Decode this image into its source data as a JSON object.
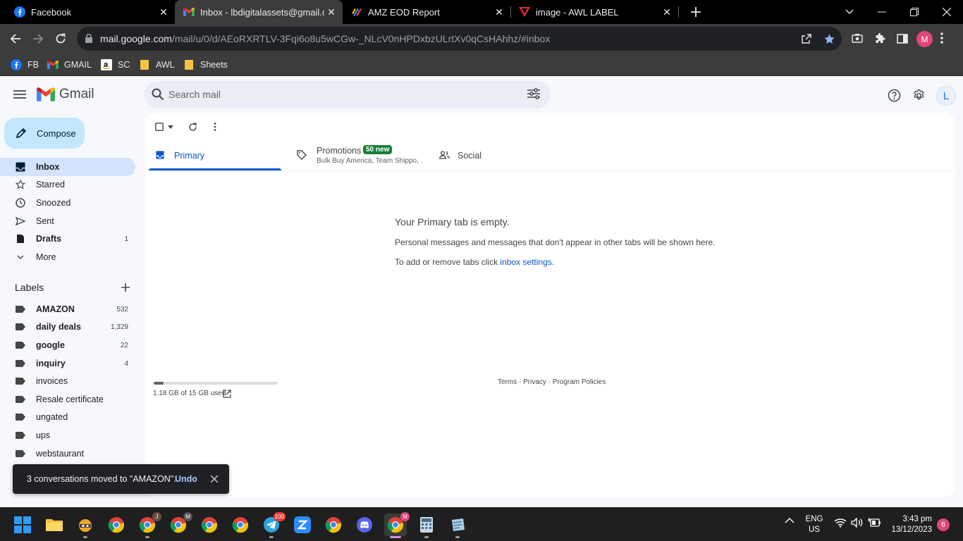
{
  "browser": {
    "tabs": [
      {
        "title": "Facebook",
        "icon": "facebook-icon"
      },
      {
        "title": "Inbox - lbdigitalassets@gmail.com",
        "icon": "gmail-icon"
      },
      {
        "title": "AMZ EOD Report",
        "icon": "sheets-icon"
      },
      {
        "title": "image - AWL LABEL",
        "icon": "awl-icon"
      }
    ],
    "url_host": "mail.google.com",
    "url_path": "/mail/u/0/d/AEoRXRTLV-3Fqi6o8u5wCGw-_NLcV0nHPDxbzULrtXv0qCsHAhhz/#inbox",
    "profile_initial": "M",
    "bookmarks": [
      {
        "label": "FB",
        "icon": "facebook-icon"
      },
      {
        "label": "GMAIL",
        "icon": "gmail-icon"
      },
      {
        "label": "SC",
        "icon": "amazon-icon"
      },
      {
        "label": "AWL",
        "icon": "folder-icon"
      },
      {
        "label": "Sheets",
        "icon": "folder-icon"
      }
    ]
  },
  "gmail": {
    "brand": "Gmail",
    "search_placeholder": "Search mail",
    "account_initial": "L",
    "compose_label": "Compose",
    "nav": [
      {
        "label": "Inbox",
        "count": ""
      },
      {
        "label": "Starred",
        "count": ""
      },
      {
        "label": "Snoozed",
        "count": ""
      },
      {
        "label": "Sent",
        "count": ""
      },
      {
        "label": "Drafts",
        "count": "1"
      },
      {
        "label": "More",
        "count": ""
      }
    ],
    "labels_heading": "Labels",
    "labels": [
      {
        "label": "AMAZON",
        "count": "532"
      },
      {
        "label": "daily deals",
        "count": "1,329"
      },
      {
        "label": "google",
        "count": "22"
      },
      {
        "label": "inquiry",
        "count": "4"
      },
      {
        "label": "invoices",
        "count": ""
      },
      {
        "label": "Resale certificate",
        "count": ""
      },
      {
        "label": "ungated",
        "count": ""
      },
      {
        "label": "ups",
        "count": ""
      },
      {
        "label": "webstaurant",
        "count": ""
      }
    ],
    "category_tabs": {
      "primary": "Primary",
      "promotions": "Promotions",
      "promotions_badge": "50 new",
      "promotions_sub": "Bulk Buy America, Team Shippo, ...",
      "social": "Social"
    },
    "empty": {
      "title": "Your Primary tab is empty.",
      "description": "Personal messages and messages that don't appear in other tabs will be shown here.",
      "settings_prefix": "To add or remove tabs click ",
      "settings_link": "inbox settings",
      "settings_suffix": "."
    },
    "storage": {
      "text": "1.18 GB of 15 GB used",
      "fraction": 0.079
    },
    "footer": "Terms · Privacy · Program Policies",
    "toast": {
      "message": "3 conversations moved to \"AMAZON\".",
      "action": "Undo"
    }
  },
  "taskbar": {
    "telegram_badge": "100",
    "chrome_active_badge": "M",
    "lang_1": "ENG",
    "lang_2": "US",
    "time": "3:43 pm",
    "date": "13/12/2023",
    "notifications": "6"
  },
  "colors": {
    "accent": "#0b57d0",
    "compose_bg": "#c2e7ff",
    "active_nav": "#d3e3fd",
    "promo_badge": "#188038"
  }
}
